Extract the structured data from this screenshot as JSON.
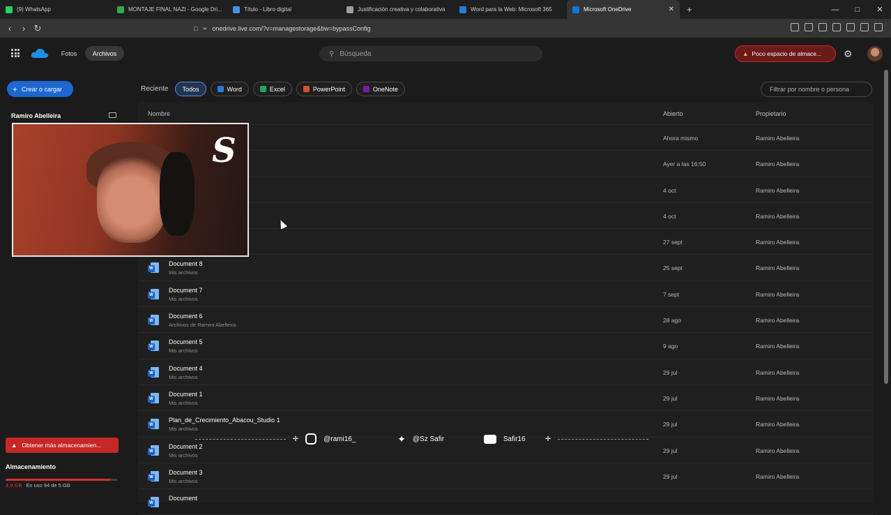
{
  "browser": {
    "tabs": [
      {
        "label": "(9) WhatsApp",
        "color": "#25d366",
        "active": false
      },
      {
        "label": "MONTAJE FINAL NAZI - Google Dri...",
        "color": "#34a853",
        "active": false
      },
      {
        "label": "Título - Libro digital",
        "color": "#4a90e2",
        "active": false
      },
      {
        "label": "Justificación creativa y colaborativa",
        "color": "#9e9e9e",
        "active": false
      },
      {
        "label": "Word para la Web: Microsoft 365",
        "color": "#2b7cd3",
        "active": false
      },
      {
        "label": "Microsoft OneDrive",
        "color": "#0f78d4",
        "active": true
      }
    ],
    "url": "onedrive.live.com/?v=managestorage&bw=bypassConfig"
  },
  "header": {
    "nav_photos": "Fotos",
    "nav_files": "Archivos",
    "search_placeholder": "Búsqueda",
    "storage_alert": "Poco espacio de almace..."
  },
  "sidebar": {
    "create_label": "Crear o cargar",
    "owner": "Ramiro Abelleira",
    "get_more": "Obtener más almacenamien...",
    "storage_title": "Almacenamiento",
    "storage_used": "4,9 GB",
    "storage_text": "En uso 94 de 5 GB",
    "storage_fraction": 0.94
  },
  "filters": {
    "label": "Reciente",
    "chips": [
      {
        "label": "Todos",
        "selected": true,
        "color": ""
      },
      {
        "label": "Word",
        "selected": false,
        "color": "#2b7cd3"
      },
      {
        "label": "Excel",
        "selected": false,
        "color": "#21a366"
      },
      {
        "label": "PowerPoint",
        "selected": false,
        "color": "#d35230"
      },
      {
        "label": "OneNote",
        "selected": false,
        "color": "#7719aa"
      }
    ],
    "filter_placeholder": "Filtrar por nombre o persona"
  },
  "table": {
    "col_name": "Nombre",
    "col_opened": "Abierto",
    "col_owner": "Propietario",
    "rows": [
      {
        "name": "",
        "loc": "",
        "opened": "Ahora mismo",
        "owner": "Ramiro Abelleira"
      },
      {
        "name": "",
        "loc": "",
        "opened": "Ayer a las 16:50",
        "owner": "Ramiro Abelleira"
      },
      {
        "name": "",
        "loc": "",
        "opened": "4 oct",
        "owner": "Ramiro Abelleira"
      },
      {
        "name": "",
        "loc": "",
        "opened": "4 oct",
        "owner": "Ramiro Abelleira"
      },
      {
        "name": "",
        "loc": "",
        "opened": "27 sept",
        "owner": "Ramiro Abelleira"
      },
      {
        "name": "Document 8",
        "loc": "Mis archivos",
        "opened": "25 sept",
        "owner": "Ramiro Abelleira"
      },
      {
        "name": "Document 7",
        "loc": "Mis archivos",
        "opened": "7 sept",
        "owner": "Ramiro Abelleira"
      },
      {
        "name": "Document 6",
        "loc": "Archivos de Ramiro Abelleira",
        "opened": "28 ago",
        "owner": "Ramiro Abelleira"
      },
      {
        "name": "Document 5",
        "loc": "Mis archivos",
        "opened": "9 ago",
        "owner": "Ramiro Abelleira"
      },
      {
        "name": "Document 4",
        "loc": "Mis archivos",
        "opened": "29 jul",
        "owner": "Ramiro Abelleira"
      },
      {
        "name": "Document 1",
        "loc": "Mis archivos",
        "opened": "29 jul",
        "owner": "Ramiro Abelleira"
      },
      {
        "name": "Plan_de_Crecimiento_Abacou_Studio 1",
        "loc": "Mis archivos",
        "opened": "29 jul",
        "owner": "Ramiro Abelleira"
      },
      {
        "name": "Document 2",
        "loc": "Mis archivos",
        "opened": "29 jul",
        "owner": "Ramiro Abelleira"
      },
      {
        "name": "Document 3",
        "loc": "Mis archivos",
        "opened": "29 jul",
        "owner": "Ramiro Abelleira"
      },
      {
        "name": "Document",
        "loc": "",
        "opened": "",
        "owner": ""
      }
    ]
  },
  "overlay": {
    "logo": "S",
    "instagram": "@rami16_",
    "twitter": "@Sz Safir",
    "youtube": "Safir16"
  }
}
